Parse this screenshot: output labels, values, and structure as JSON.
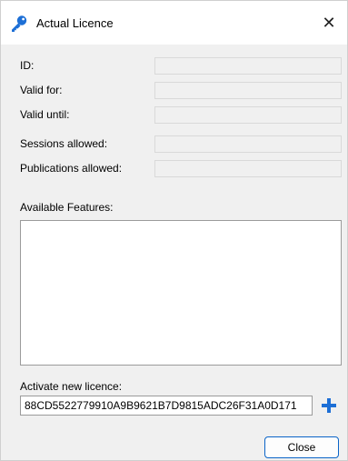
{
  "window": {
    "title": "Actual Licence",
    "icon": "key-icon",
    "close_glyph": "✕"
  },
  "fields": {
    "id_label": "ID:",
    "valid_for_label": "Valid for:",
    "valid_until_label": "Valid until:",
    "sessions_label": "Sessions allowed:",
    "publications_label": "Publications allowed:"
  },
  "features": {
    "label": "Available Features:"
  },
  "activate": {
    "label": "Activate new licence:",
    "value": "88CD5522779910A9B9621B7D9815ADC26F31A0D171",
    "add_icon": "plus-icon"
  },
  "buttons": {
    "close_label": "Close"
  },
  "colors": {
    "accent": "#1d6fd6",
    "button_border": "#0a64c8"
  }
}
